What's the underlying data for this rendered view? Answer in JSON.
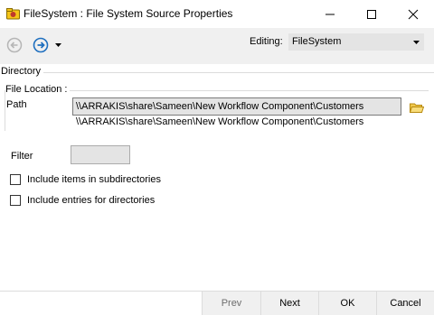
{
  "window": {
    "title": "FileSystem : File System Source Properties",
    "controls": [
      "minimize",
      "maximize",
      "close"
    ]
  },
  "toolbar": {
    "back_icon": "back-arrow-icon",
    "forward_icon": "forward-arrow-icon",
    "editing_label": "Editing:",
    "editing_value": "FileSystem"
  },
  "directory": {
    "section_label": "Directory",
    "file_location_label": "File Location :",
    "path_label": "Path",
    "path_value": "\\\\ARRAKIS\\share\\Sameen\\New Workflow Component\\Customers",
    "path_resolved": "\\\\ARRAKIS\\share\\Sameen\\New Workflow Component\\Customers",
    "browse_icon": "folder-open-icon"
  },
  "filter": {
    "label": "Filter",
    "value": ""
  },
  "options": [
    {
      "label": "Include items in subdirectories",
      "checked": false
    },
    {
      "label": "Include entries for directories",
      "checked": false
    }
  ],
  "footer": {
    "prev": "Prev",
    "next": "Next",
    "ok": "OK",
    "cancel": "Cancel"
  },
  "colors": {
    "accent": "#1e6fbf",
    "toolbar_bg": "#f0f0f0",
    "input_bg": "#e4e4e4"
  }
}
